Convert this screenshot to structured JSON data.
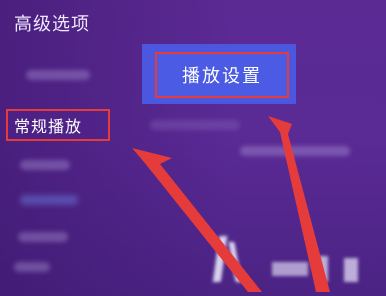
{
  "header": {
    "title": "高级选项"
  },
  "menu": {
    "selected_label": "常规播放"
  },
  "content": {
    "play_settings_label": "播放设置"
  },
  "annotation": {
    "arrow_color": "#e53b3b",
    "highlight_border_color": "#e53b3b"
  }
}
